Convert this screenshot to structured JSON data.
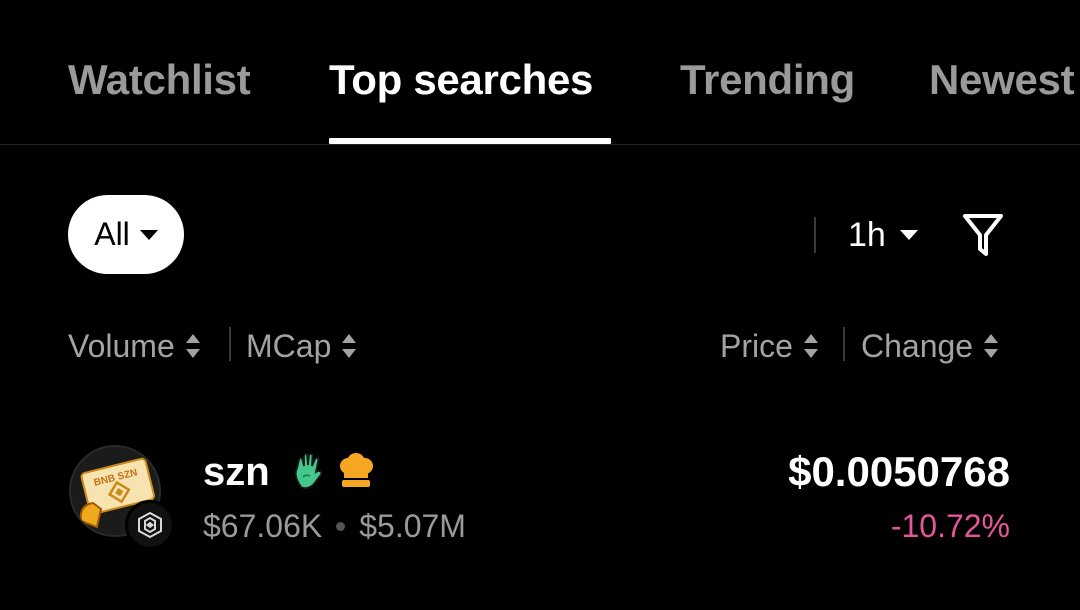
{
  "tabs": [
    {
      "label": "Watchlist",
      "active": false
    },
    {
      "label": "Top searches",
      "active": true
    },
    {
      "label": "Trending",
      "active": false
    },
    {
      "label": "Newest",
      "active": false
    }
  ],
  "filters": {
    "category": {
      "label": "All",
      "icon": "caret-down-icon"
    },
    "timeframe": {
      "label": "1h",
      "icon": "caret-down-icon"
    },
    "filter_icon": "funnel-icon"
  },
  "columns": {
    "volume": "Volume",
    "mcap": "MCap",
    "price": "Price",
    "change": "Change",
    "sort_icon": "sort-updown-icon"
  },
  "tokens": [
    {
      "name": "szn",
      "logo_text": "BNB SZN",
      "badges": [
        "waving-hand-icon",
        "chef-hat-icon"
      ],
      "chain_icon": "bnb-chain-icon",
      "volume": "$67.06K",
      "mcap": "$5.07M",
      "price": "$0.0050768",
      "change": "-10.72%"
    }
  ],
  "colors": {
    "background": "#000000",
    "tab_inactive": "#9a9a9a",
    "negative_change": "#e5579a",
    "hand_badge": "#43c98c",
    "chef_badge": "#f5a623"
  }
}
